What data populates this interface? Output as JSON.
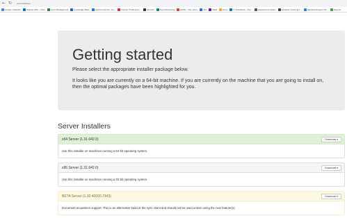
{
  "browser": {
    "url": "sync.fm/server",
    "bookmarks": [
      {
        "label": "Google Calendar",
        "color": "#4285f4"
      },
      {
        "label": "Outlook Web - Cisco",
        "color": "#0072c6"
      },
      {
        "label": "Sync Management",
        "color": "#2e7d32"
      },
      {
        "label": "Knowledge Base",
        "color": "#1565c0"
      },
      {
        "label": "Sophos Central - Ho...",
        "color": "#1a73e8"
      },
      {
        "label": "Partner Portal and I...",
        "color": "#d32f2f"
      },
      {
        "label": "Security",
        "color": "#333333"
      },
      {
        "label": "Sync Monitoring",
        "color": "#00897b"
      },
      {
        "label": "Netflix - Flex Inbox",
        "color": "#e53935"
      },
      {
        "label": "Jira",
        "color": "#1976d2"
      },
      {
        "label": "Slack",
        "color": "#6a1b9a"
      },
      {
        "label": "Drive",
        "color": "#f9a825"
      },
      {
        "label": "IT Freshdesk - Sup...",
        "color": "#0277bd"
      },
      {
        "label": "Deployment Status",
        "color": "#455a64"
      },
      {
        "label": "Zendesk Incoming T...",
        "color": "#37474f"
      },
      {
        "label": "Zendesk Support Sh...",
        "color": "#1e88e5"
      },
      {
        "label": "Support",
        "color": "#43a047"
      }
    ]
  },
  "hero": {
    "title": "Getting started",
    "line1": "Please select the appropriate installer package below.",
    "line2": "It looks like you are currently on a 64-bit machine. If you are currently on the machine that you are going to install on, then the optimal packages have been highlighted for you."
  },
  "section": {
    "title": "Server Installers"
  },
  "installers": {
    "x64": {
      "title": "x64 Server (1.31.642.0)",
      "button": "Download ▾",
      "desc": "Use this installer on machines running a 64-bit operating system."
    },
    "x86": {
      "title": "x86 Server (1.31.642.0)",
      "button": "Download ▾",
      "desc": "Use this installer on machines running a 32-bit operating system."
    },
    "beta": {
      "title": "BETA Server (1.30.40000.7343)",
      "button": "Download ▾",
      "desc": "Document acquisition support. This is an alternative build of the sync client and should not be used unless using the new feature(s)."
    }
  },
  "colors": {
    "recommended_header": "#dff0d8",
    "beta_header": "#fcf8e3",
    "jumbotron": "#ececec"
  }
}
